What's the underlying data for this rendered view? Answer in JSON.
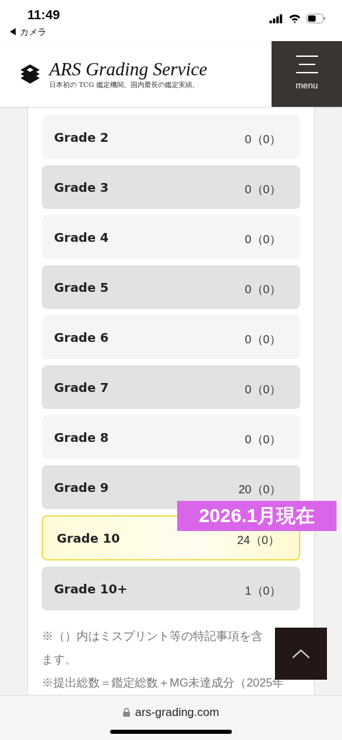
{
  "status_bar": {
    "time": "11:49",
    "back_label": "◀ カメラ"
  },
  "header": {
    "title": "ARS Grading Service",
    "tagline": "日本初の TCG 鑑定機関。国内最長の鑑定実績。",
    "menu_label": "menu"
  },
  "grades": [
    {
      "label": "Grade 2",
      "count": "0（0）",
      "highlighted": false
    },
    {
      "label": "Grade 3",
      "count": "0（0）",
      "highlighted": false
    },
    {
      "label": "Grade 4",
      "count": "0（0）",
      "highlighted": false
    },
    {
      "label": "Grade 5",
      "count": "0（0）",
      "highlighted": false
    },
    {
      "label": "Grade 6",
      "count": "0（0）",
      "highlighted": false
    },
    {
      "label": "Grade 7",
      "count": "0（0）",
      "highlighted": false
    },
    {
      "label": "Grade 8",
      "count": "0（0）",
      "highlighted": false
    },
    {
      "label": "Grade 9",
      "count": "20（0）",
      "highlighted": false
    },
    {
      "label": "Grade 10",
      "count": "24（0）",
      "highlighted": true
    },
    {
      "label": "Grade 10+",
      "count": "1（0）",
      "highlighted": false
    }
  ],
  "date_badge": "2026.1月現在",
  "notes": [
    "※（）内はミスプリント等の特記事項を含",
    "ます。",
    "※提出総数＝鑑定総数＋MG未達成分（2025年"
  ],
  "browser_bar": {
    "url": "ars-grading.com"
  }
}
